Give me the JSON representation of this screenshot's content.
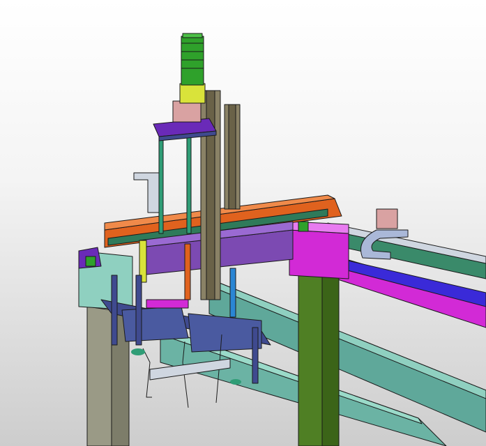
{
  "viewport": {
    "background_top": "#ffffff",
    "background_bottom": "#cdcdcd"
  },
  "colors": {
    "motor": "#2fa12b",
    "motor_coupler": "#d9e33a",
    "top_plate": "#6a2ab8",
    "column_green": "#4f7f24",
    "column_grey": "#9a9a86",
    "beam_orange": "#e0621e",
    "carriage_magenta": "#d22ad6",
    "rail_blue": "#3a2ad8",
    "rail_teal": "#5fa89a",
    "bracket_navy": "#3f4a8f",
    "cable_chain_grey": "#8a8266",
    "cable_chain_blue": "#aab8d8",
    "cylinder_blue": "#2a86d4",
    "gripper_teal": "#2f9d76",
    "slide_purple": "#7c4ab2",
    "steel_light": "#cfd6e0",
    "outline": "#1a1a1a"
  },
  "components": [
    {
      "name": "servo-motor"
    },
    {
      "name": "lift-column-left"
    },
    {
      "name": "lift-column-right"
    },
    {
      "name": "gantry-beam"
    },
    {
      "name": "x-axis-rail"
    },
    {
      "name": "support-leg"
    },
    {
      "name": "gripper-head"
    },
    {
      "name": "cable-chain"
    }
  ]
}
